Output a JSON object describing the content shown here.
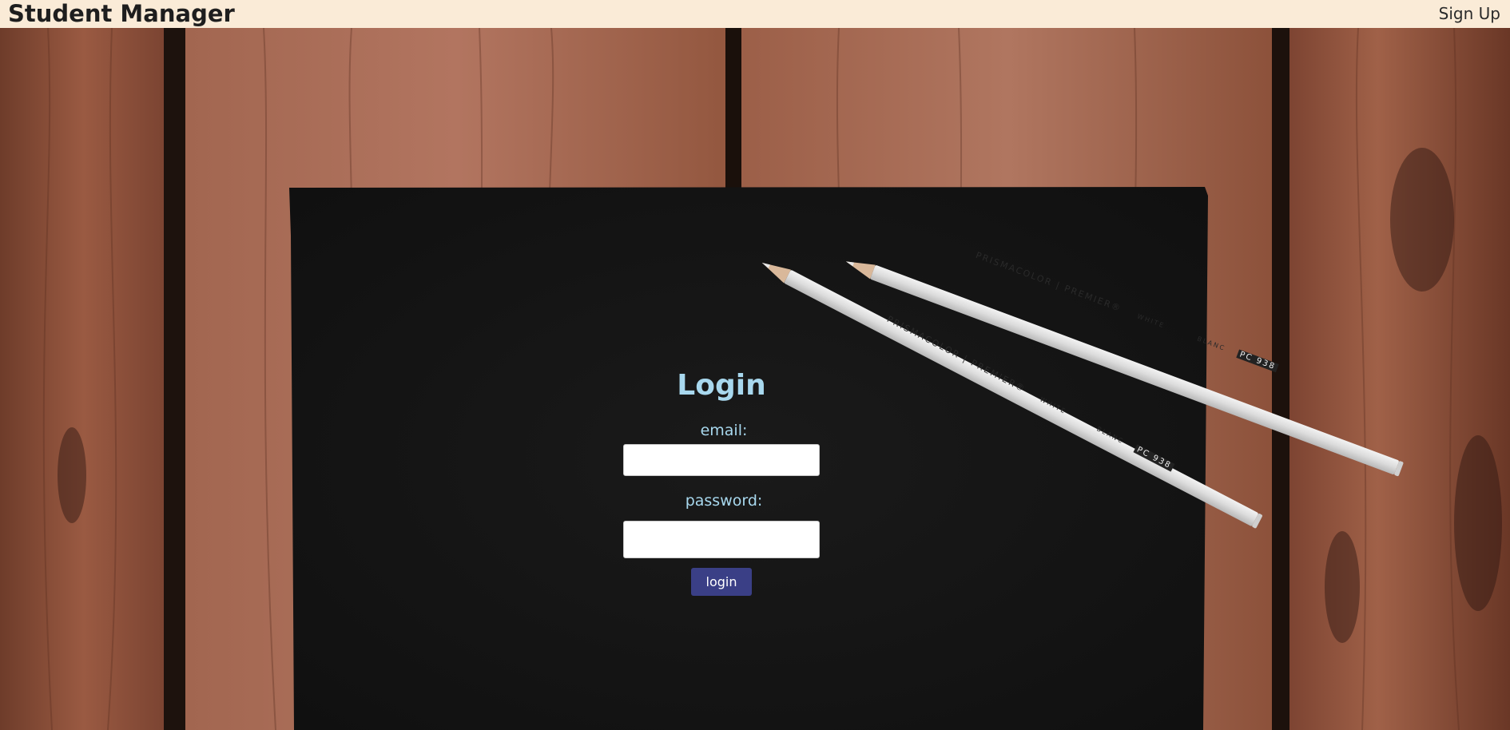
{
  "navbar": {
    "brand": "Student Manager",
    "signup_label": "Sign Up"
  },
  "background": {
    "description_icon": "wood-desk-with-black-paper-and-pencils-image",
    "pencil_text_1": "PRISMACOLOR | PREMIER®",
    "pencil_text_2": "WHITE",
    "pencil_text_3": "BLANC",
    "pencil_code": "PC 938"
  },
  "login": {
    "title": "Login",
    "email_label": "email:",
    "email_value": "",
    "password_label": "password:",
    "password_value": "",
    "button_label": "login"
  },
  "colors": {
    "navbar_bg": "#faebd7",
    "label_color": "#a8d8ee",
    "button_bg": "#3a3f86",
    "paper": "#141414",
    "wood": "#8a4e36"
  }
}
